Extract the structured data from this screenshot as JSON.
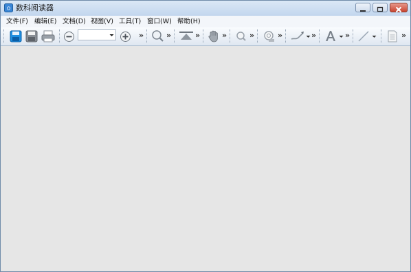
{
  "window": {
    "title": "数科阅读器"
  },
  "menu": {
    "file": "文件(F)",
    "edit": "编辑(E)",
    "document": "文档(D)",
    "view": "视图(V)",
    "tools": "工具(T)",
    "window": "窗口(W)",
    "help": "帮助(H)"
  },
  "toolbar": {
    "zoom_value": "",
    "overflow_label": "»",
    "icons": [
      "save-icon",
      "save-disk-icon",
      "print-icon",
      "zoom-out-icon",
      "zoom-in-icon",
      "search-icon",
      "fit-page-icon",
      "hand-icon",
      "magnifier-icon",
      "stamp-icon",
      "pen-icon",
      "text-icon",
      "line-icon",
      "note-icon"
    ]
  },
  "colors": {
    "titlebar": "#c8dbf1",
    "workspace": "#e6e6e6",
    "close": "#c94532"
  }
}
